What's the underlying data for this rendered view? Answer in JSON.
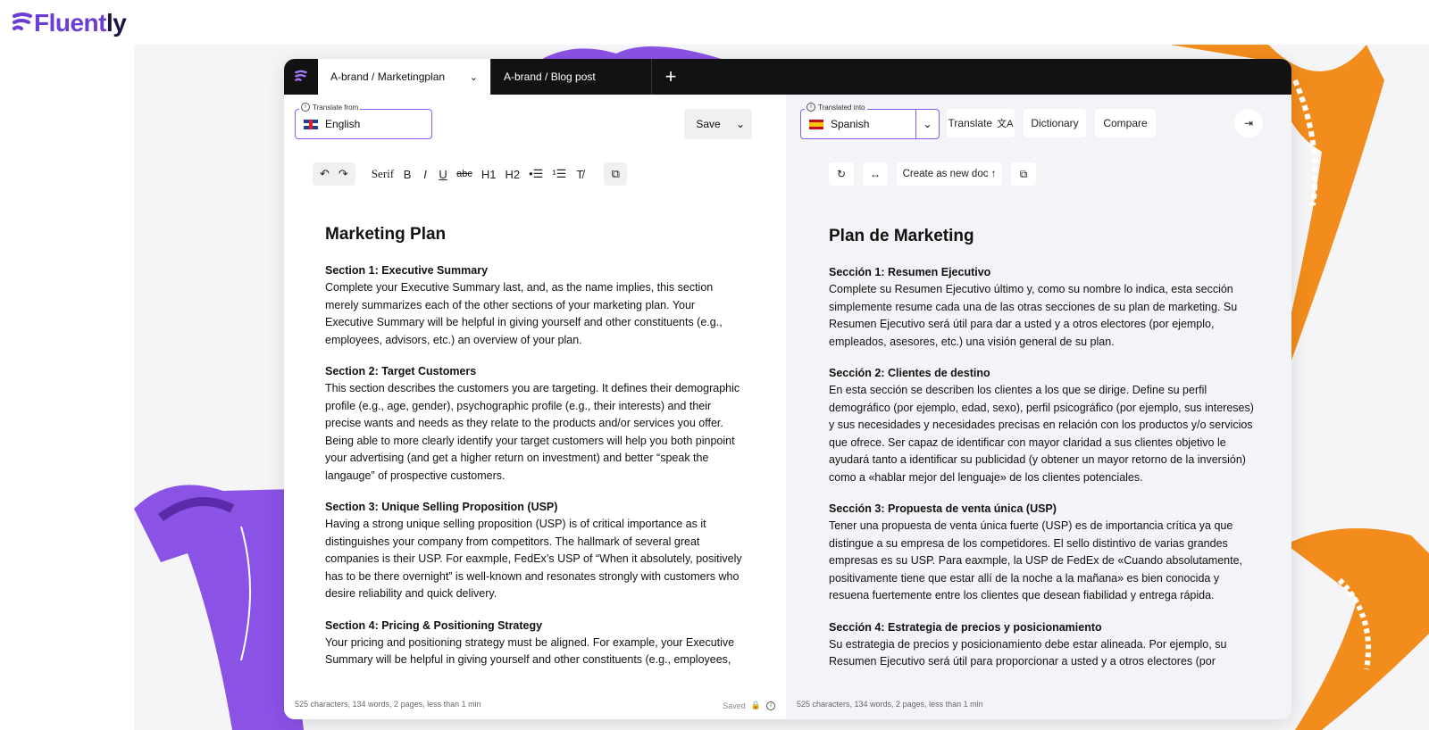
{
  "brand": {
    "name_main": "Fluent",
    "name_tail": "ly",
    "accent": "#7c3aed",
    "orange": "#f28c1c"
  },
  "tabs": [
    {
      "label": "A-brand / Marketingplan",
      "active": true
    },
    {
      "label": "A-brand / Blog post",
      "active": false
    }
  ],
  "left": {
    "legend": "Translate from",
    "language": "English",
    "save_label": "Save",
    "toolbar": {
      "undo_icon": "undo-icon",
      "redo_icon": "redo-icon",
      "serif": "Serif",
      "bold": "B",
      "italic": "I",
      "underline": "U",
      "strike": "abc",
      "h1": "H1",
      "h2": "H2",
      "bullets": "•☰",
      "numbered": "¹☰",
      "clear": "T̸"
    },
    "doc": {
      "title": "Marketing Plan",
      "sections": [
        {
          "heading": "Section 1: Executive Summary",
          "body": "Complete your Executive Summary last, and, as the name implies, this section merely summarizes each of the other sections of your marketing plan. Your Executive Summary will be helpful in giving yourself and other constituents (e.g., employees, advisors, etc.) an overview of your plan."
        },
        {
          "heading": "Section 2: Target Customers",
          "body": "This section describes the customers you are targeting. It defines their demographic profile (e.g., age, gender), psychographic profile (e.g., their interests) and their precise wants and needs as they relate to the products and/or services you offer. Being able to more clearly identify your target customers will help you both pinpoint your advertising (and get a higher return on investment) and better “speak the langauge” of prospective customers."
        },
        {
          "heading": "Section 3: Unique Selling Proposition (USP)",
          "body": "Having a strong unique selling proposition (USP) is of critical importance as it distinguishes your company from competitors. The hallmark of several great companies is their USP. For eaxmple, FedEx’s USP of “When it absolutely, positively has to be there overnight” is well-known and resonates strongly with customers who desire reliability and quick delivery."
        },
        {
          "heading": "Section 4: Pricing & Positioning Strategy",
          "body": "Your pricing and positioning strategy must be aligned. For example, your Executive Summary will be helpful in giving yourself and other constituents (e.g., employees,"
        }
      ]
    },
    "status": "525 characters, 134 words, 2 pages, less than 1 min",
    "saved": "Saved"
  },
  "right": {
    "legend": "Translated into",
    "language": "Spanish",
    "translate_label": "Translate",
    "dictionary_label": "Dictionary",
    "compare_label": "Compare",
    "create_doc_label": "Create as new doc ↑",
    "doc": {
      "title": "Plan de Marketing",
      "sections": [
        {
          "heading": "Sección 1: Resumen Ejecutivo",
          "body": "Complete su Resumen Ejecutivo último y, como su nombre lo indica, esta sección simplemente resume cada una de las otras secciones de su plan de marketing. Su Resumen Ejecutivo será útil para dar a usted y a otros electores (por ejemplo, empleados, asesores, etc.) una visión general de su plan."
        },
        {
          "heading": "Sección 2: Clientes de destino",
          "body": "En esta sección se describen los clientes a los que se dirige. Define su perfil demográfico (por ejemplo, edad, sexo), perfil psicográfico (por ejemplo, sus intereses) y sus necesidades y necesidades precisas en relación con los productos y/o servicios que ofrece. Ser capaz de identificar con mayor claridad a sus clientes objetivo le ayudará tanto a identificar su publicidad (y obtener un mayor retorno de la inversión) como a «hablar mejor del lenguaje» de los clientes potenciales."
        },
        {
          "heading": "Sección 3: Propuesta de venta única (USP)",
          "body": "Tener una propuesta de venta única fuerte (USP) es de importancia crítica ya que distingue a su empresa de los competidores. El sello distintivo de varias grandes empresas es su USP. Para eaxmple, la USP de FedEx de «Cuando absolutamente, positivamente tiene que estar allí de la noche a la mañana» es bien conocida y resuena fuertemente entre los clientes que desean fiabilidad y entrega rápida."
        },
        {
          "heading": "Sección 4: Estrategia de precios y posicionamiento",
          "body": "Su estrategia de precios y posicionamiento debe estar alineada. Por ejemplo, su Resumen Ejecutivo será útil para proporcionar a usted y a otros electores (por"
        }
      ]
    },
    "status": "525 characters, 134 words, 2 pages, less than 1 min"
  }
}
